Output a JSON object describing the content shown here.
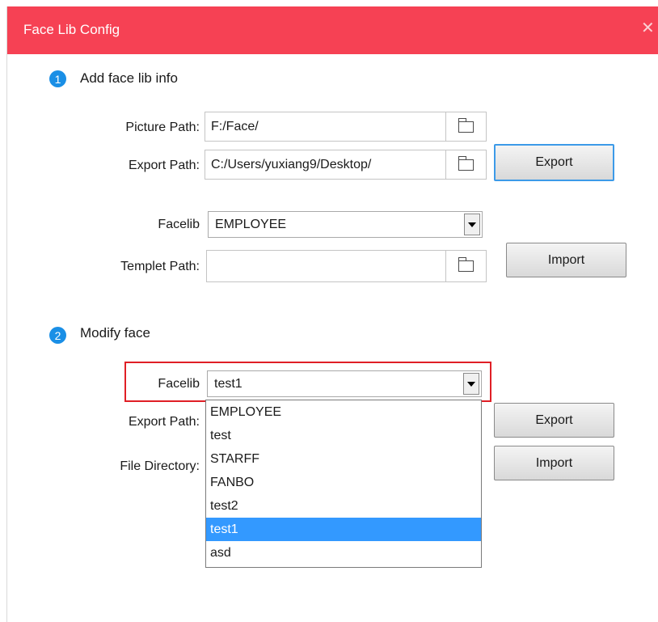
{
  "window": {
    "title": "Face Lib Config",
    "close_glyph": "✕"
  },
  "step1": {
    "number": "1",
    "title": "Add face lib info",
    "picture_path_label": "Picture Path:",
    "picture_path_value": "F:/Face/",
    "export_path_label": "Export Path:",
    "export_path_value": "C:/Users/yuxiang9/Desktop/",
    "export_button": "Export",
    "facelib_label": "Facelib",
    "facelib_value": "EMPLOYEE",
    "templet_path_label": "Templet Path:",
    "templet_path_value": "",
    "import_button": "Import"
  },
  "step2": {
    "number": "2",
    "title": "Modify face",
    "facelib_label": "Facelib",
    "facelib_value": "test1",
    "export_path_label": "Export Path:",
    "file_directory_label": "File Directory:",
    "export_button": "Export",
    "import_button": "Import",
    "dropdown_options": [
      "EMPLOYEE",
      "test",
      "STARFF",
      "FANBO",
      "test2",
      "test1",
      "asd"
    ],
    "selected_option": "test1"
  },
  "colors": {
    "titlebar": "#f64154",
    "accent": "#1a8fe6",
    "selection": "#3399ff",
    "highlight_box": "#e01f26"
  },
  "icons": {
    "browse": "folder-icon",
    "close": "close-icon",
    "dropdown": "chevron-down-icon"
  }
}
